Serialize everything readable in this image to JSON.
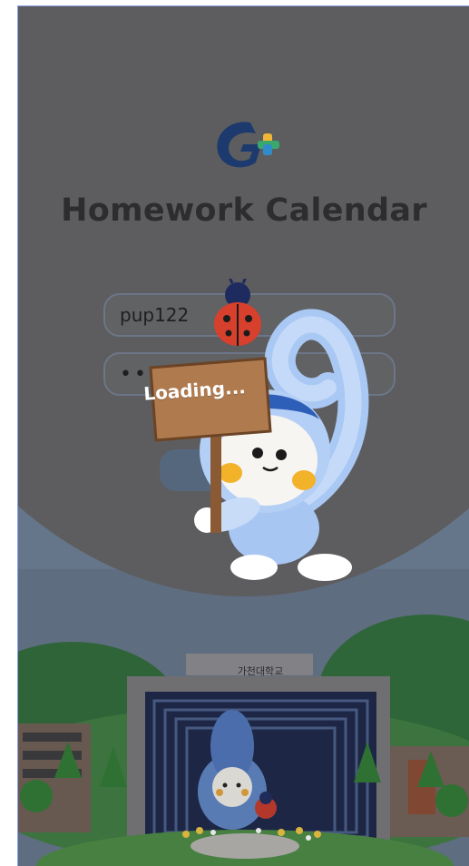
{
  "app": {
    "title": "Homework Calendar",
    "logo_icon": "gachon-g-logo-icon"
  },
  "login": {
    "username_value": "pup122",
    "password_value": "••",
    "submit_icon": "login-button"
  },
  "loading": {
    "text": "Loading...",
    "mascot_icon": "mascot-character-icon",
    "ladybug_icon": "ladybug-icon"
  },
  "background": {
    "building_sign": "가천대학교",
    "scene_icon": "campus-building-illustration"
  },
  "colors": {
    "overlay": "#5d5d5f",
    "title": "#2d2d30",
    "sky": "#65768a",
    "logo_blue": "#1d3a6e",
    "logo_yellow": "#f2b637",
    "logo_green": "#3aa86c",
    "sign_board": "#a97650"
  }
}
